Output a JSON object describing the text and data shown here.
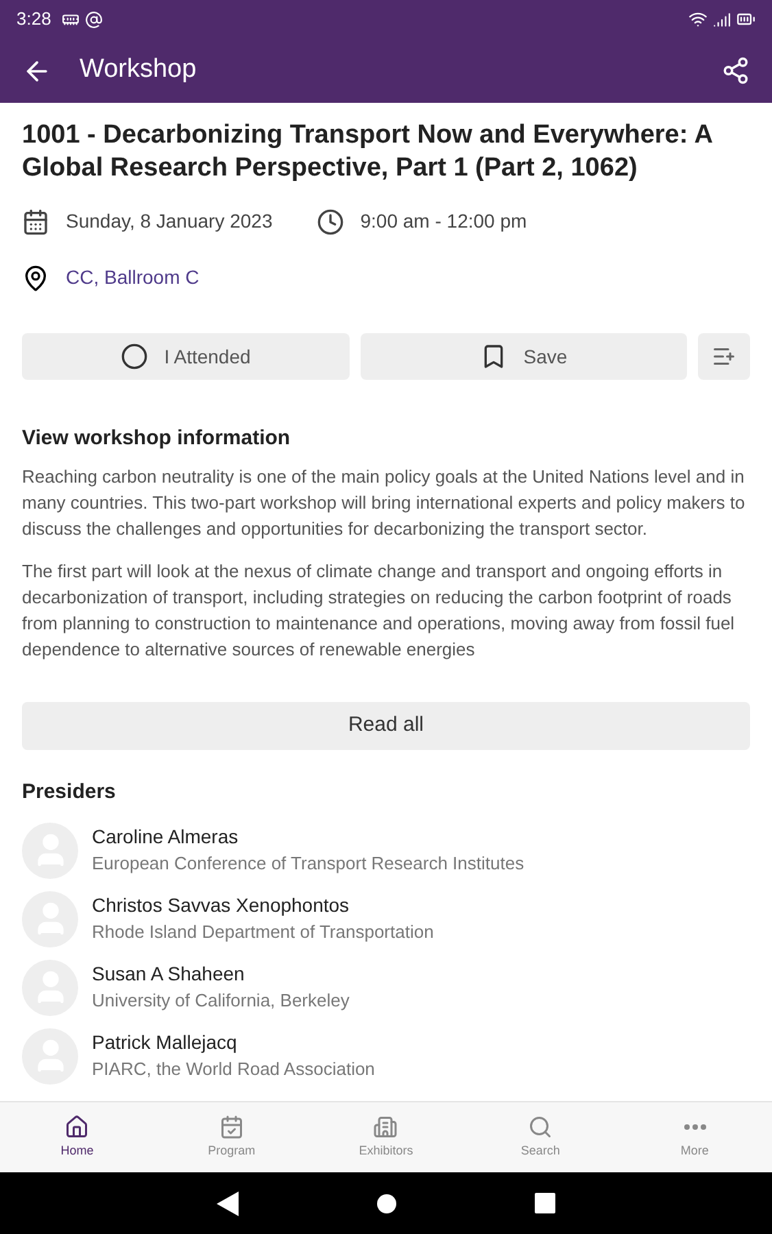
{
  "status_bar": {
    "time": "3:28"
  },
  "app_bar": {
    "title": "Workshop"
  },
  "session": {
    "title": "1001 - Decarbonizing Transport Now and Everywhere: A Global Research Perspective, Part 1 (Part 2, 1062)",
    "date": "Sunday, 8 January 2023",
    "time": "9:00 am - 12:00 pm",
    "location": "CC, Ballroom C"
  },
  "actions": [
    {
      "kind": "attended",
      "label": "I Attended",
      "checked": false
    },
    {
      "kind": "save",
      "label": "Save",
      "checked": false
    },
    {
      "kind": "add"
    }
  ],
  "info": {
    "heading": "View workshop information",
    "paragraphs": [
      "Reaching carbon neutrality is one of the main policy goals at the United Nations level and in many countries. This two-part workshop will bring international experts and policy makers to discuss the challenges and opportunities for decarbonizing the transport sector.",
      "The first part will look at the nexus of climate change and transport and ongoing efforts in decarbonization of transport, including strategies on reducing the carbon footprint of roads from planning to construction to maintenance and operations, moving away from fossil fuel dependence to alternative sources of renewable energies"
    ],
    "read_all": "Read all"
  },
  "presiders": {
    "heading": "Presiders",
    "items": [
      {
        "name": "Caroline Almeras",
        "affiliation": "European Conference of Transport Research Institutes"
      },
      {
        "name": "Christos Savvas Xenophontos",
        "affiliation": "Rhode Island Department of Transportation"
      },
      {
        "name": "Susan A Shaheen",
        "affiliation": "University of California, Berkeley"
      },
      {
        "name": "Patrick Mallejacq",
        "affiliation": "PIARC, the World Road Association"
      }
    ]
  },
  "bottom_nav": [
    {
      "kind": "home",
      "label": "Home",
      "selected": true
    },
    {
      "kind": "program",
      "label": "Program",
      "selected": false
    },
    {
      "kind": "exhibitors",
      "label": "Exhibitors",
      "selected": false
    },
    {
      "kind": "search",
      "label": "Search",
      "selected": false
    },
    {
      "kind": "more",
      "label": "More",
      "selected": false
    }
  ]
}
